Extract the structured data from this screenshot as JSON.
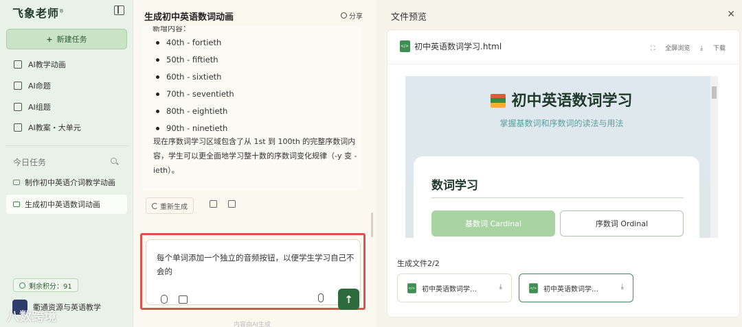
{
  "sidebar": {
    "logo": "飞象老师",
    "logo_mark": "®",
    "new_task": "新建任务",
    "menu": [
      {
        "label": "AI教学动画"
      },
      {
        "label": "AI命题"
      },
      {
        "label": "AI组题"
      },
      {
        "label": "AI教案・大单元"
      }
    ],
    "today_label": "今日任务",
    "tasks": [
      {
        "label": "制作初中英语介词教学动画"
      },
      {
        "label": "生成初中英语数词动画"
      }
    ],
    "points": "剩余积分：91",
    "user_name": "衢通资源与英语教学",
    "watermark": "八数跨境"
  },
  "chat": {
    "title": "生成初中英语数词动画",
    "share": "分享",
    "cut_line": "新增内容：",
    "list": [
      "40th - fortieth",
      "50th - fiftieth",
      "60th - sixtieth",
      "70th - seventieth",
      "80th - eightieth",
      "90th - ninetieth"
    ],
    "paragraph": "现在序数词学习区域包含了从 1st 到 100th 的完整序数词内容，学生可以更全面地学习整十数的序数词变化规律（-y 变 -ieth）。",
    "regenerate": "重新生成",
    "input_text": "每个单词添加一个独立的音频按钮，以便学生学习自己不会的",
    "footnote": "内容由AI生成"
  },
  "preview": {
    "title": "文件预览",
    "file_name": "初中英语数词学习.html",
    "fullscreen": "全屏浏览",
    "download": "下载",
    "page": {
      "title": "初中英语数词学习",
      "subtitle": "掌握基数词和序数词的读法与用法",
      "section": "数词学习",
      "btn_cardinal": "基数词 Cardinal",
      "btn_ordinal": "序数词 Ordinal"
    },
    "generated_label": "生成文件2/2",
    "files": [
      {
        "name": "初中英语数词学…"
      },
      {
        "name": "初中英语数词学…"
      }
    ]
  },
  "colors": {
    "accent": "#2d6a3c",
    "highlight_border": "#d9534f",
    "sidebar_bg": "#e9f2e8"
  }
}
